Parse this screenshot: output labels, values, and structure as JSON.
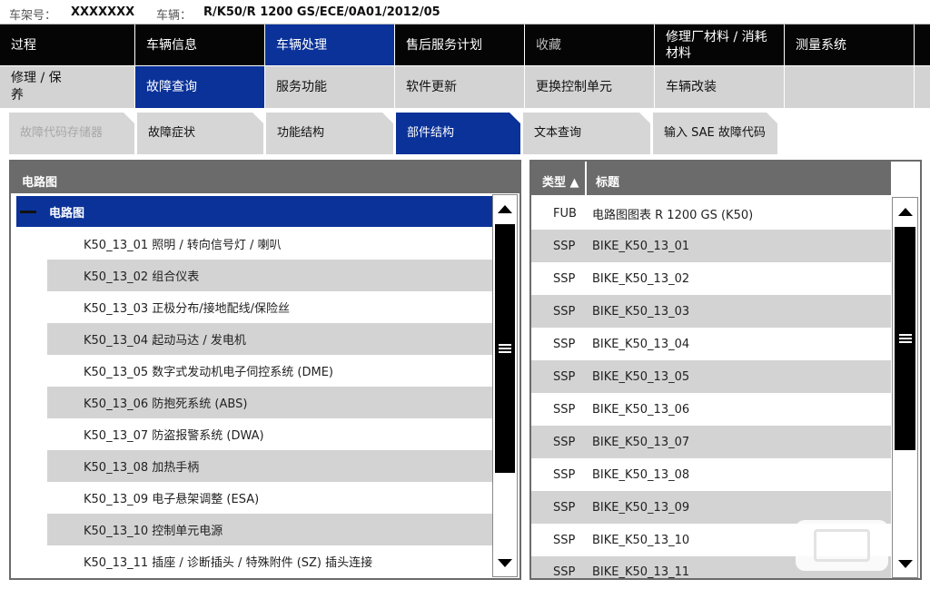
{
  "header": {
    "vin_label": "车架号：",
    "vin_value": "XXXXXXX",
    "vehicle_label": "车辆：",
    "vehicle_value": "R/K50/R 1200 GS/ECE/0A01/2012/05"
  },
  "main_tabs": [
    {
      "label": "过程"
    },
    {
      "label": "车辆信息"
    },
    {
      "label": "车辆处理"
    },
    {
      "label": "售后服务计划"
    },
    {
      "label": "收藏"
    },
    {
      "label": "修理厂材料 / 消耗材料"
    },
    {
      "label": "测量系统"
    }
  ],
  "sub_tabs": [
    {
      "label": "修理 / 保养"
    },
    {
      "label": "故障查询"
    },
    {
      "label": "服务功能"
    },
    {
      "label": "软件更新"
    },
    {
      "label": "更换控制单元"
    },
    {
      "label": "车辆改装"
    }
  ],
  "third_tabs": [
    {
      "label": "故障代码存储器"
    },
    {
      "label": "故障症状"
    },
    {
      "label": "功能结构"
    },
    {
      "label": "部件结构"
    },
    {
      "label": "文本查询"
    },
    {
      "label": "输入 SAE 故障代码"
    }
  ],
  "left_panel": {
    "title": "电路图",
    "root_label": "电路图",
    "items": [
      {
        "label": "K50_13_01 照明 / 转向信号灯 / 喇叭"
      },
      {
        "label": "K50_13_02 组合仪表"
      },
      {
        "label": "K50_13_03 正极分布/接地配线/保险丝"
      },
      {
        "label": "K50_13_04 起动马达 / 发电机"
      },
      {
        "label": "K50_13_05 数字式发动机电子伺控系统 (DME)"
      },
      {
        "label": "K50_13_06 防抱死系统 (ABS)"
      },
      {
        "label": "K50_13_07 防盗报警系统 (DWA)"
      },
      {
        "label": "K50_13_08 加热手柄"
      },
      {
        "label": "K50_13_09 电子悬架调整 (ESA)"
      },
      {
        "label": "K50_13_10 控制单元电源"
      },
      {
        "label": "K50_13_11 插座 / 诊断插头 / 特殊附件 (SZ) 插头连接"
      }
    ]
  },
  "right_panel": {
    "col_type": "类型 ▲",
    "col_title": "标题",
    "rows": [
      {
        "type": "FUB",
        "title": "电路图图表 R 1200 GS (K50)"
      },
      {
        "type": "SSP",
        "title": "BIKE_K50_13_01"
      },
      {
        "type": "SSP",
        "title": "BIKE_K50_13_02"
      },
      {
        "type": "SSP",
        "title": "BIKE_K50_13_03"
      },
      {
        "type": "SSP",
        "title": "BIKE_K50_13_04"
      },
      {
        "type": "SSP",
        "title": "BIKE_K50_13_05"
      },
      {
        "type": "SSP",
        "title": "BIKE_K50_13_06"
      },
      {
        "type": "SSP",
        "title": "BIKE_K50_13_07"
      },
      {
        "type": "SSP",
        "title": "BIKE_K50_13_08"
      },
      {
        "type": "SSP",
        "title": "BIKE_K50_13_09"
      },
      {
        "type": "SSP",
        "title": "BIKE_K50_13_10"
      },
      {
        "type": "SSP",
        "title": "BIKE_K50_13_11"
      }
    ]
  },
  "colors": {
    "active_blue": "#0a3299",
    "menu_black": "#050505",
    "panel_gray": "#6b6b6b",
    "row_gray": "#d3d3d3"
  },
  "icons": [
    "collapse-icon",
    "scroll-up-icon",
    "scroll-down-icon",
    "scroll-grip-icon"
  ]
}
